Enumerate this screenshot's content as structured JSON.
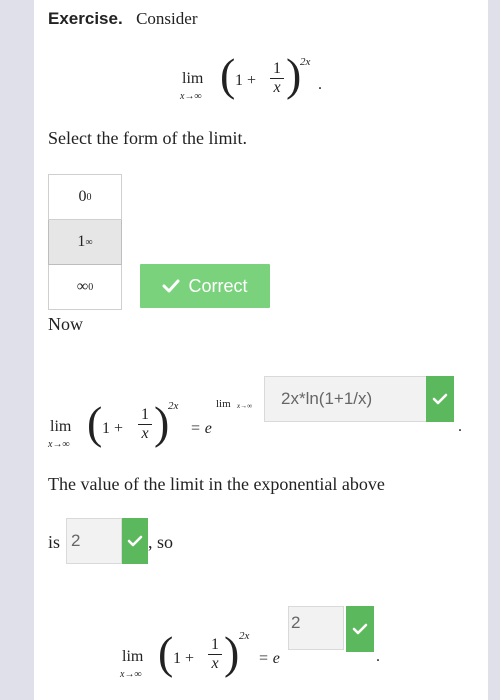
{
  "exercise": {
    "heading_bold": "Exercise.",
    "heading_text": "Consider",
    "expr_lim": "lim",
    "expr_sub": "x→∞",
    "expr_one_plus": "1 +",
    "expr_num": "1",
    "expr_den": "x",
    "expr_exp": "2x",
    "expr_period": "."
  },
  "question": {
    "prompt": "Select the form of the limit.",
    "choices": [
      {
        "base": "0",
        "exp": "0"
      },
      {
        "base": "1",
        "exp": "∞"
      },
      {
        "base": "∞",
        "exp": "0"
      }
    ],
    "selected_index": 1,
    "status_label": "Correct",
    "status_color": "#7bd27d"
  },
  "now": {
    "label": "Now",
    "equals_e": "= e",
    "exp_lim": "lim",
    "exp_sub": "x→∞",
    "answer1": "2x*ln(1+1/x)",
    "period": "."
  },
  "value": {
    "sentence": "The value of the limit in the exponential above",
    "is_label": "is",
    "answer2": "2",
    "so_label": ", so"
  },
  "final": {
    "equals_e": "= e",
    "answer3": "2",
    "period": "."
  },
  "colors": {
    "check_green": "#5cb85c",
    "sidebar": "#dfe0ea"
  }
}
